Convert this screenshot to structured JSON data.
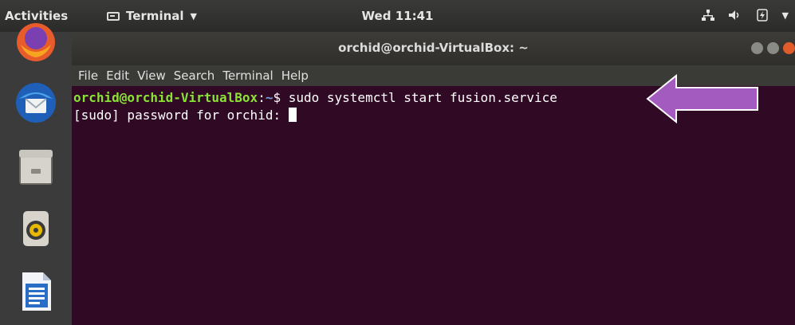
{
  "topbar": {
    "activities": "Activities",
    "app_menu": "Terminal",
    "clock": "Wed 11:41",
    "tray_icons": [
      "network-icon",
      "volume-icon",
      "power-icon",
      "chevron-down-icon"
    ]
  },
  "dock": {
    "items": [
      "firefox-icon",
      "thunderbird-icon",
      "files-icon",
      "rhythmbox-icon",
      "libreoffice-writer-icon"
    ]
  },
  "window": {
    "title": "orchid@orchid-VirtualBox: ~",
    "menu": [
      "File",
      "Edit",
      "View",
      "Search",
      "Terminal",
      "Help"
    ],
    "lines": {
      "prompt_user": "orchid@orchid-VirtualBox",
      "prompt_sep": ":",
      "prompt_path": "~",
      "prompt_end": "$ ",
      "command": "sudo systemctl start fusion.service",
      "sudo_prompt": "[sudo] password for orchid: "
    }
  },
  "colors": {
    "terminal_bg": "#300a24",
    "prompt_user": "#8ae234",
    "prompt_path": "#729fcf",
    "arrow": "#a35bbf"
  }
}
